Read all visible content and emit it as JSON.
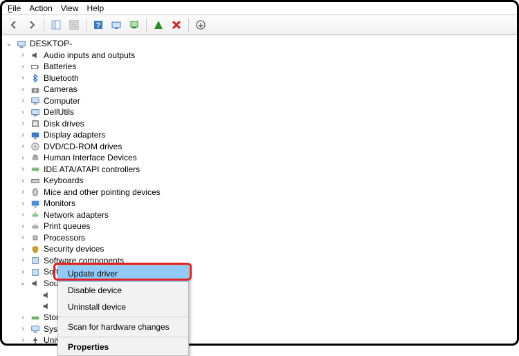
{
  "menu": {
    "file": "File",
    "action": "Action",
    "view": "View",
    "help": "Help"
  },
  "root": {
    "label": "DESKTOP-"
  },
  "categories": [
    {
      "label": "Audio inputs and outputs",
      "icon": "speaker"
    },
    {
      "label": "Batteries",
      "icon": "battery"
    },
    {
      "label": "Bluetooth",
      "icon": "bluetooth"
    },
    {
      "label": "Cameras",
      "icon": "camera"
    },
    {
      "label": "Computer",
      "icon": "computer"
    },
    {
      "label": "DellUtils",
      "icon": "computer"
    },
    {
      "label": "Disk drives",
      "icon": "disk"
    },
    {
      "label": "Display adapters",
      "icon": "display"
    },
    {
      "label": "DVD/CD-ROM drives",
      "icon": "cd"
    },
    {
      "label": "Human Interface Devices",
      "icon": "hid"
    },
    {
      "label": "IDE ATA/ATAPI controllers",
      "icon": "ide"
    },
    {
      "label": "Keyboards",
      "icon": "keyboard"
    },
    {
      "label": "Mice and other pointing devices",
      "icon": "mouse"
    },
    {
      "label": "Monitors",
      "icon": "monitor"
    },
    {
      "label": "Network adapters",
      "icon": "network"
    },
    {
      "label": "Print queues",
      "icon": "printer"
    },
    {
      "label": "Processors",
      "icon": "cpu"
    },
    {
      "label": "Security devices",
      "icon": "security"
    },
    {
      "label": "Software components",
      "icon": "software"
    },
    {
      "label": "Software devices",
      "icon": "software"
    }
  ],
  "expandedCategory": {
    "label": "Sound, video and game controllers",
    "icon": "speaker"
  },
  "childStub": {
    "label": ""
  },
  "remaining": [
    {
      "label": "Stor",
      "icon": "ide"
    },
    {
      "label": "Syst",
      "icon": "computer"
    },
    {
      "label": "Univ",
      "icon": "usb"
    }
  ],
  "context": {
    "update": "Update driver",
    "disable": "Disable device",
    "uninstall": "Uninstall device",
    "scan": "Scan for hardware changes",
    "properties": "Properties"
  }
}
